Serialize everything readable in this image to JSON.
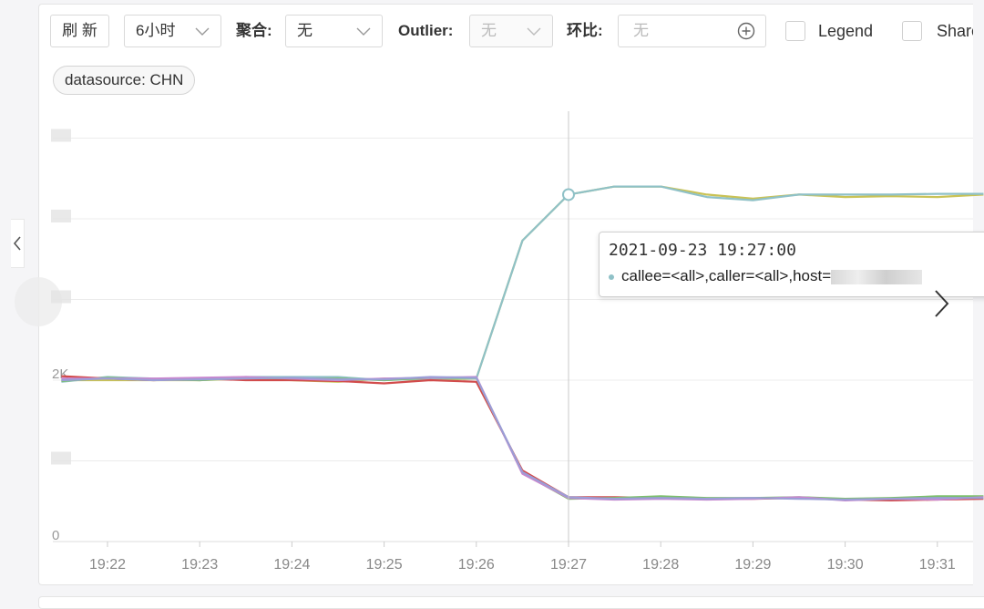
{
  "toolbar": {
    "refresh_label": "刷 新",
    "time_range": "6小时",
    "aggregate_label": "聚合:",
    "aggregate_value": "无",
    "outlier_label": "Outlier:",
    "outlier_value": "无",
    "ratio_label": "环比:",
    "ratio_placeholder": "无",
    "legend_label": "Legend",
    "share_label": "Share"
  },
  "filter_tag": "datasource: CHN",
  "tooltip": {
    "time": "2021-09-23 19:27:00",
    "series_label": "callee=<all>,caller=<all>,host="
  },
  "colors": {
    "high_series": "#c9c255",
    "high_series_alt": "#8fc1c7",
    "low_series": [
      "#d24b4b",
      "#7cbf6b",
      "#c987cf",
      "#9b9ed6",
      "#f0a25a",
      "#6fb5c9"
    ]
  },
  "icons": [
    "chevron-down-icon",
    "plus-circle-icon",
    "chevron-left-icon",
    "chevron-right-icon"
  ],
  "chart_data": {
    "type": "line",
    "x": [
      "19:22",
      "19:23",
      "19:24",
      "19:25",
      "19:26",
      "19:27",
      "19:28",
      "19:29",
      "19:30",
      "19:31"
    ],
    "y_ticks": [
      "0",
      "2K"
    ],
    "crosshair_x": "19:27",
    "series": [
      {
        "color": "#c9c255",
        "points": [
          [
            21.5,
            2.0
          ],
          [
            22,
            2.0
          ],
          [
            22.5,
            2.0
          ],
          [
            23,
            2.0
          ],
          [
            23.5,
            2.02
          ],
          [
            24,
            2.0
          ],
          [
            24.5,
            1.98
          ],
          [
            25,
            2.02
          ],
          [
            25.5,
            2.0
          ],
          [
            26,
            2.02
          ],
          [
            26.5,
            3.73
          ],
          [
            27,
            4.3
          ],
          [
            27.5,
            4.4
          ],
          [
            28,
            4.4
          ],
          [
            28.5,
            4.3
          ],
          [
            29,
            4.25
          ],
          [
            29.5,
            4.3
          ],
          [
            30,
            4.27
          ],
          [
            30.5,
            4.28
          ],
          [
            31,
            4.27
          ],
          [
            31.5,
            4.3
          ]
        ]
      },
      {
        "color": "#8fc1c7",
        "points": [
          [
            21.5,
            1.98
          ],
          [
            22,
            2.04
          ],
          [
            22.5,
            2.02
          ],
          [
            23,
            2.0
          ],
          [
            23.5,
            2.04
          ],
          [
            24,
            2.04
          ],
          [
            24.5,
            2.04
          ],
          [
            25,
            2.0
          ],
          [
            25.5,
            2.02
          ],
          [
            26,
            2.02
          ],
          [
            26.5,
            3.73
          ],
          [
            27,
            4.3
          ],
          [
            27.5,
            4.4
          ],
          [
            28,
            4.4
          ],
          [
            28.5,
            4.27
          ],
          [
            29,
            4.23
          ],
          [
            29.5,
            4.3
          ],
          [
            30,
            4.3
          ],
          [
            30.5,
            4.3
          ],
          [
            31,
            4.31
          ],
          [
            31.5,
            4.31
          ]
        ]
      },
      {
        "color": "#d24b4b",
        "points": [
          [
            21.5,
            2.05
          ],
          [
            22,
            2.02
          ],
          [
            22.5,
            2.0
          ],
          [
            23,
            2.02
          ],
          [
            23.5,
            2.0
          ],
          [
            24,
            2.0
          ],
          [
            24.5,
            1.99
          ],
          [
            25,
            1.96
          ],
          [
            25.5,
            2.0
          ],
          [
            26,
            1.98
          ],
          [
            26.5,
            0.88
          ],
          [
            27,
            0.55
          ],
          [
            27.5,
            0.55
          ],
          [
            28,
            0.54
          ],
          [
            28.5,
            0.53
          ],
          [
            29,
            0.53
          ],
          [
            29.5,
            0.54
          ],
          [
            30,
            0.52
          ],
          [
            30.5,
            0.51
          ],
          [
            31,
            0.52
          ],
          [
            31.5,
            0.53
          ]
        ]
      },
      {
        "color": "#7cbf6b",
        "points": [
          [
            21.5,
            1.99
          ],
          [
            22,
            2.03
          ],
          [
            22.5,
            2.01
          ],
          [
            23,
            2.0
          ],
          [
            23.5,
            2.03
          ],
          [
            24,
            2.02
          ],
          [
            24.5,
            2.02
          ],
          [
            25,
            2.0
          ],
          [
            25.5,
            2.03
          ],
          [
            26,
            2.03
          ],
          [
            26.5,
            0.85
          ],
          [
            27,
            0.53
          ],
          [
            27.5,
            0.54
          ],
          [
            28,
            0.56
          ],
          [
            28.5,
            0.54
          ],
          [
            29,
            0.54
          ],
          [
            29.5,
            0.55
          ],
          [
            30,
            0.53
          ],
          [
            30.5,
            0.54
          ],
          [
            31,
            0.56
          ],
          [
            31.5,
            0.56
          ]
        ]
      },
      {
        "color": "#c987cf",
        "points": [
          [
            21.5,
            2.02
          ],
          [
            22,
            2.02
          ],
          [
            22.5,
            2.02
          ],
          [
            23,
            2.03
          ],
          [
            23.5,
            2.04
          ],
          [
            24,
            2.02
          ],
          [
            24.5,
            2.0
          ],
          [
            25,
            2.02
          ],
          [
            25.5,
            2.03
          ],
          [
            26,
            2.04
          ],
          [
            26.5,
            0.84
          ],
          [
            27,
            0.54
          ],
          [
            27.5,
            0.52
          ],
          [
            28,
            0.53
          ],
          [
            28.5,
            0.52
          ],
          [
            29,
            0.53
          ],
          [
            29.5,
            0.55
          ],
          [
            30,
            0.51
          ],
          [
            30.5,
            0.53
          ],
          [
            31,
            0.52
          ],
          [
            31.5,
            0.55
          ]
        ]
      },
      {
        "color": "#9b9ed6",
        "points": [
          [
            21.5,
            2.0
          ],
          [
            22,
            2.02
          ],
          [
            22.5,
            2.0
          ],
          [
            23,
            2.01
          ],
          [
            23.5,
            2.02
          ],
          [
            24,
            2.03
          ],
          [
            24.5,
            2.01
          ],
          [
            25,
            2.01
          ],
          [
            25.5,
            2.04
          ],
          [
            26,
            2.03
          ],
          [
            26.5,
            0.86
          ],
          [
            27,
            0.55
          ],
          [
            27.5,
            0.53
          ],
          [
            28,
            0.54
          ],
          [
            28.5,
            0.53
          ],
          [
            29,
            0.54
          ],
          [
            29.5,
            0.53
          ],
          [
            30,
            0.52
          ],
          [
            30.5,
            0.53
          ],
          [
            31,
            0.54
          ],
          [
            31.5,
            0.54
          ]
        ]
      }
    ]
  }
}
